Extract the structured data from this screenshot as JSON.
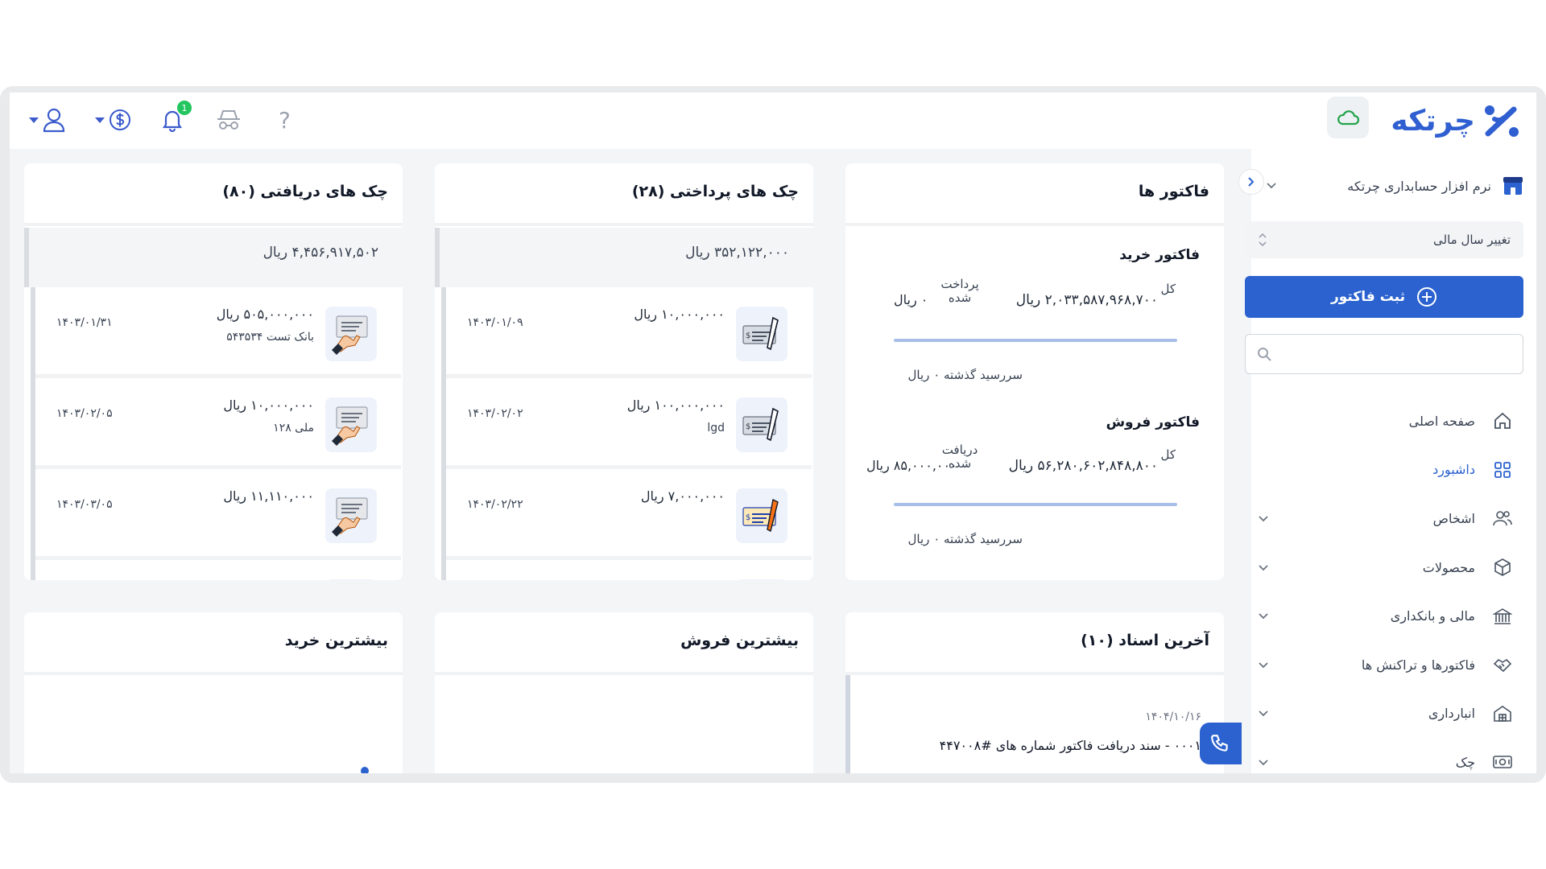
{
  "app": {
    "logo_text": "چرتکه"
  },
  "topbar": {
    "notification_count": "1",
    "help_label": "?"
  },
  "sidebar": {
    "company": "نرم افزار حسابداری چرتکه",
    "fiscal_year_label": "تغییر سال مالی",
    "new_invoice_label": "ثبت فاکتور",
    "search_placeholder": "",
    "items": [
      {
        "label": "صفحه اصلی",
        "icon": "home-icon",
        "expandable": false,
        "active": false
      },
      {
        "label": "داشبورد",
        "icon": "dashboard-icon",
        "expandable": false,
        "active": true
      },
      {
        "label": "اشخاص",
        "icon": "people-icon",
        "expandable": true,
        "active": false
      },
      {
        "label": "محصولات",
        "icon": "box-icon",
        "expandable": true,
        "active": false
      },
      {
        "label": "مالی و بانکداری",
        "icon": "bank-icon",
        "expandable": true,
        "active": false
      },
      {
        "label": "فاکتورها و تراکنش ها",
        "icon": "handshake-icon",
        "expandable": true,
        "active": false
      },
      {
        "label": "انبارداری",
        "icon": "warehouse-icon",
        "expandable": true,
        "active": false
      },
      {
        "label": "چک",
        "icon": "check-icon",
        "expandable": true,
        "active": false
      }
    ]
  },
  "invoices": {
    "title": "فاکتور ها",
    "purchase": {
      "title": "فاکتور خرید",
      "total_label": "کل",
      "total": "۲,۰۳۳,۵۸۷,۹۶۸,۷۰۰ ریال",
      "paid_label": "پرداخت شده",
      "paid": "۰ ریال",
      "overdue": "سررسید گذشته ۰ ریال"
    },
    "sales": {
      "title": "فاکتور فروش",
      "total_label": "کل",
      "total": "۵۶,۲۸۰,۶۰۲,۸۴۸,۸۰۰ ریال",
      "received_label": "دریافت شده",
      "received": "۸۵,۰۰۰,۰۰۰ ریال",
      "overdue": "سررسید گذشته ۰ ریال"
    }
  },
  "payable_checks": {
    "title": "چک های پرداختی (۲۸)",
    "total": "۳۵۲,۱۲۲,۰۰۰ ریال",
    "rows": [
      {
        "amount": "۱۰,۰۰۰,۰۰۰ ریال",
        "sub": "",
        "date": "۱۴۰۳/۰۱/۰۹",
        "icon": "check-pen-icon"
      },
      {
        "amount": "۱۰۰,۰۰۰,۰۰۰ ریال",
        "sub": "lgd",
        "date": "۱۴۰۳/۰۲/۰۲",
        "icon": "check-pen-icon"
      },
      {
        "amount": "۷,۰۰۰,۰۰۰ ریال",
        "sub": "",
        "date": "۱۴۰۳/۰۲/۲۲",
        "icon": "check-pen-yellow-icon"
      }
    ]
  },
  "receivable_checks": {
    "title": "چک های دریافتی (۸۰)",
    "total": "۴,۴۵۶,۹۱۷,۵۰۲ ریال",
    "rows": [
      {
        "amount": "۵۰۵,۰۰۰,۰۰۰ ریال",
        "sub": "بانک تست ۵۴۳۵۳۴",
        "date": "۱۴۰۳/۰۱/۳۱",
        "icon": "hand-check-icon"
      },
      {
        "amount": "۱۰,۰۰۰,۰۰۰ ریال",
        "sub": "ملی ۱۲۸",
        "date": "۱۴۰۳/۰۲/۰۵",
        "icon": "hand-check-icon"
      },
      {
        "amount": "۱۱,۱۱۰,۰۰۰ ریال",
        "sub": "",
        "date": "۱۴۰۳/۰۳/۰۵",
        "icon": "hand-check-icon"
      }
    ]
  },
  "latest_docs": {
    "title": "آخرین اسناد (۱۰)",
    "date": "۱۴۰۴/۱۰/۱۶",
    "text": "۰۰۰۱ - سند دریافت فاکتور شماره های #۴۴۷۰۰۸"
  },
  "top_sales": {
    "title": "بیشترین فروش"
  },
  "top_purchases": {
    "title": "بیشترین خرید"
  },
  "colors": {
    "primary": "#2b62cf",
    "badge": "#22c55e",
    "cloud": "#22a34a"
  }
}
